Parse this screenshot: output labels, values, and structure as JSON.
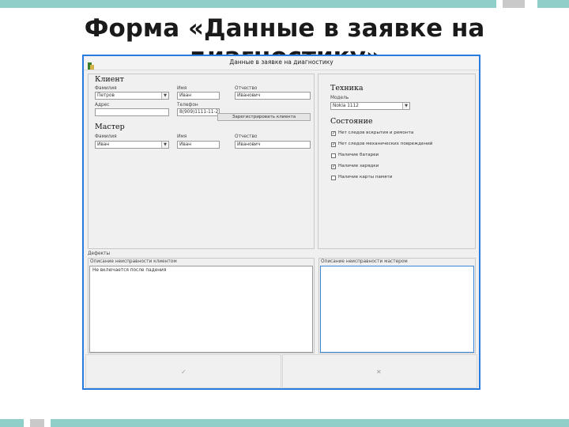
{
  "slide": {
    "title": "Форма «Данные в заявке на диагностику»"
  },
  "window": {
    "title": "Данные в заявке на диагностику"
  },
  "client": {
    "group_title": "Клиент",
    "surname_label": "Фамилия",
    "surname_value": "Петров",
    "name_label": "Имя",
    "name_value": "Иван",
    "patronymic_label": "Отчество",
    "patronymic_value": "Иванович",
    "address_label": "Адрес",
    "address_value": "",
    "phone_label": "Телефон",
    "phone_value": "8(909)1111-11-27",
    "register_button": "Зарегистрировать клиента"
  },
  "master": {
    "group_title": "Мастер",
    "surname_label": "Фамилия",
    "surname_value": "Иван",
    "name_label": "Имя",
    "name_value": "Иван",
    "patronymic_label": "Отчество",
    "patronymic_value": "Иванович"
  },
  "technique": {
    "group_title": "Техника",
    "model_label": "Модель",
    "model_value": "Nokia 1112"
  },
  "state": {
    "group_title": "Состояние",
    "items": [
      {
        "label": "Нет следов вскрытия и ремонта",
        "checked": "✓"
      },
      {
        "label": "Нет следов механических повреждений",
        "checked": "✓"
      },
      {
        "label": "Наличие батареи",
        "checked": ""
      },
      {
        "label": "Наличие зарядки",
        "checked": "✓"
      },
      {
        "label": "Наличие карты памяти",
        "checked": ""
      }
    ]
  },
  "defects": {
    "label": "Дефекты",
    "left_caption": "Описание неисправности клиентом",
    "left_text": "Не включается после падения",
    "right_caption": "Описание неисправности мастером",
    "right_text": ""
  },
  "buttons": {
    "ok_label": "✓",
    "cancel_label": "✕"
  }
}
